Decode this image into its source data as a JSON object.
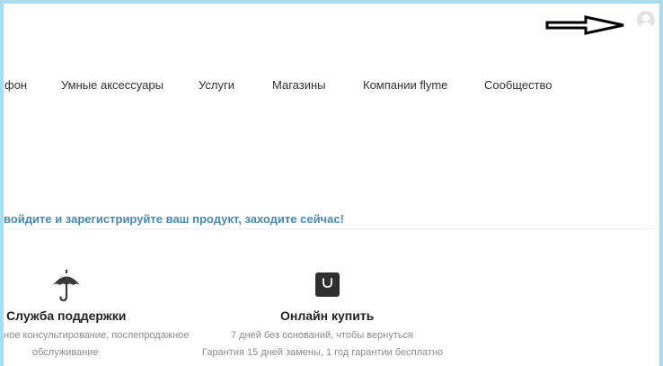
{
  "header": {
    "user_icon": "user-avatar-icon",
    "annotation": "arrow-pointing-right"
  },
  "nav": {
    "items": [
      {
        "label": "фон"
      },
      {
        "label": "Умные аксессуары"
      },
      {
        "label": "Услуги"
      },
      {
        "label": "Магазины"
      },
      {
        "label": "Компании flyme"
      },
      {
        "label": "Сообщество"
      }
    ]
  },
  "promo": {
    "text": "войдите и зарегистрируйте ваш продукт, заходите сейчас!"
  },
  "features": [
    {
      "icon": "umbrella-icon",
      "title": "Служба поддержки",
      "line1": "ное консультирование, послепродажное",
      "line2": "обслуживание"
    },
    {
      "icon": "shopping-bag-icon",
      "title": "Онлайн купить",
      "line1": "7 дней без оснований, чтобы вернуться",
      "line2": "Гарантия 15 дней замены, 1 год гарантии бесплатно"
    }
  ],
  "colors": {
    "frame": "#a9dcef",
    "promo": "#4a89b0",
    "text": "#333333",
    "muted": "#8c8c8c"
  }
}
